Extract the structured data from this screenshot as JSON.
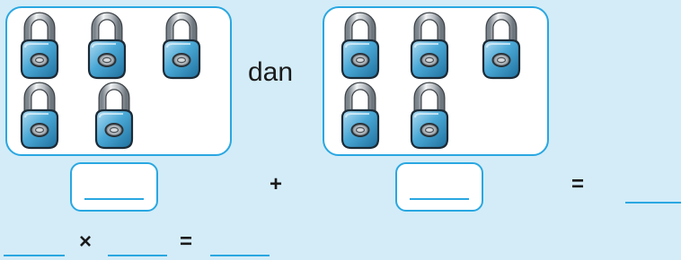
{
  "groups": [
    {
      "lock_count": 5,
      "icon": "padlock-icon"
    },
    {
      "lock_count": 5,
      "icon": "padlock-icon"
    }
  ],
  "conjunction": "dan",
  "addition_row": {
    "plus": "+",
    "equals": "="
  },
  "multiplication_row": {
    "times": "×",
    "equals": "="
  },
  "colors": {
    "background": "#d3ecf8",
    "border": "#29a7e1",
    "lock_body": "#4aa8d6",
    "shackle": "#c9ced3"
  }
}
